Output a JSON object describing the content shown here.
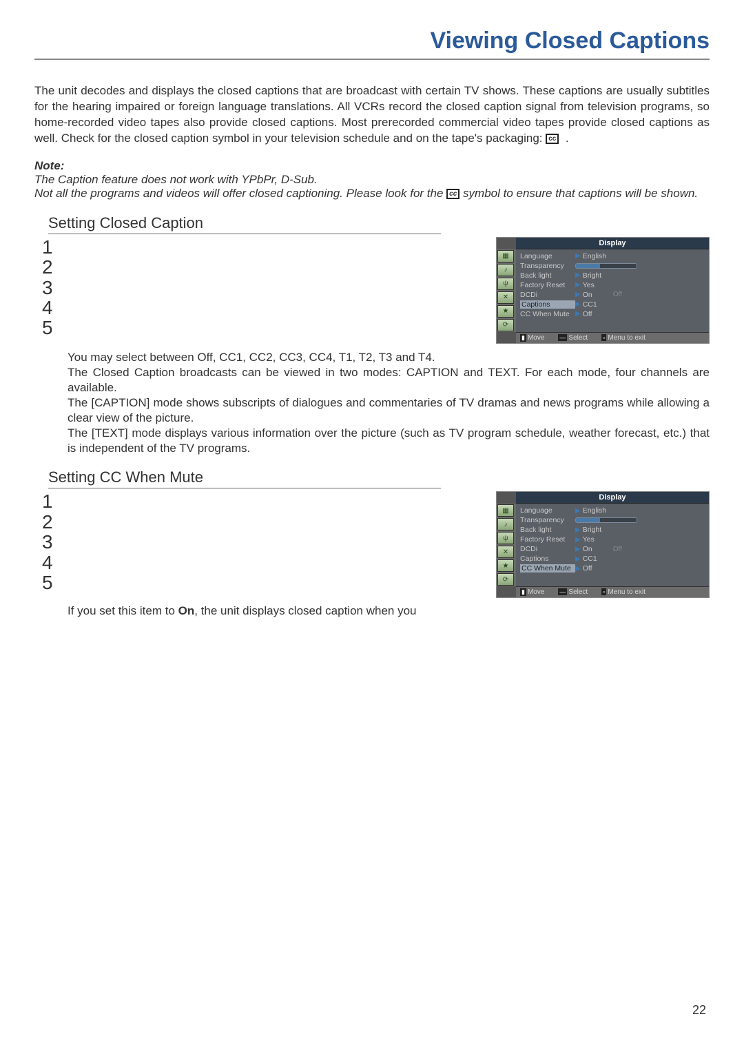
{
  "page_title": "Viewing Closed Captions",
  "intro": "The unit decodes and displays the closed captions that are broadcast with certain TV shows. These captions are usually subtitles for the hearing impaired or foreign language translations. All VCRs record the closed caption signal from television programs, so home-recorded video tapes also provide closed captions. Most prerecorded commercial video tapes provide closed captions as well. Check for the closed caption symbol in your television schedule and on the tape's packaging:",
  "cc_symbol": "cc",
  "note": {
    "label": "Note:",
    "line1": "The Caption feature does not work with YPbPr, D-Sub.",
    "line2a": "Not all the programs and videos will offer closed captioning. Please look for the",
    "line2b": "symbol to ensure that captions will be shown."
  },
  "section1": {
    "title": "Setting Closed Caption",
    "steps": [
      "1",
      "2",
      "3",
      "4",
      "5"
    ],
    "detail": "You may select between Off, CC1, CC2, CC3, CC4, T1, T2, T3 and  T4.\nThe Closed Caption broadcasts can be viewed in two modes: CAPTION and TEXT. For each mode, four channels are available.\nThe [CAPTION] mode shows subscripts of dialogues and commentaries of TV dramas and news programs while allowing a clear view of the picture.\nThe [TEXT] mode displays various information over the picture (such as TV program schedule, weather forecast, etc.) that is independent of the TV programs."
  },
  "section2": {
    "title": "Setting CC When Mute",
    "steps": [
      "1",
      "2",
      "3",
      "4",
      "5"
    ],
    "detail_a": "If you set this item to ",
    "detail_bold": "On",
    "detail_b": ", the unit displays closed caption when you"
  },
  "osd": {
    "header": "Display",
    "rows": {
      "language": {
        "label": "Language",
        "value": "English"
      },
      "transparency": {
        "label": "Transparency"
      },
      "backlight": {
        "label": "Back light",
        "value": "Bright"
      },
      "factory": {
        "label": "Factory Reset",
        "value": "Yes"
      },
      "dcdi": {
        "label": "DCDi",
        "value": "On",
        "extra": "Off"
      },
      "captions": {
        "label": "Captions",
        "value": "CC1"
      },
      "ccmute": {
        "label": "CC When Mute",
        "value": "Off"
      }
    },
    "footer": {
      "move": "Move",
      "select": "Select",
      "exit": "Menu to exit"
    }
  },
  "page_number": "22"
}
